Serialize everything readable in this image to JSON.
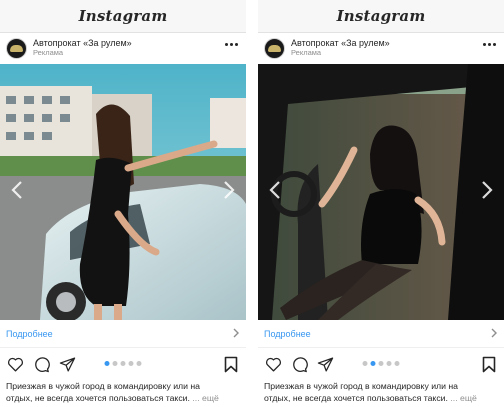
{
  "app": {
    "logo_text": "Instagram"
  },
  "posts": [
    {
      "account_name": "Автопрокат «За рулем»",
      "sponsored": "Реклама",
      "cta_label": "Подробнее",
      "caption_line1": "Приезжая в чужой город в командировку или на",
      "caption_line2": "отдых, не всегда хочется пользоваться такси.",
      "caption_more": "... ещё",
      "carousel_index": 1,
      "carousel_count": 5
    },
    {
      "account_name": "Автопрокат «За рулем»",
      "sponsored": "Реклама",
      "cta_label": "Подробнее",
      "caption_line1": "Приезжая в чужой город в командировку или на",
      "caption_line2": "отдых, не всегда хочется пользоваться такси.",
      "caption_more": "... ещё",
      "carousel_index": 2,
      "carousel_count": 5
    }
  ],
  "colors": {
    "link": "#3897f0",
    "dot_active": "#3897f0",
    "dot_inactive": "#c7c7c7"
  },
  "icons": [
    "more-options-icon",
    "chevron-left-icon",
    "chevron-right-icon",
    "heart-icon",
    "comment-icon",
    "share-icon",
    "bookmark-icon"
  ]
}
